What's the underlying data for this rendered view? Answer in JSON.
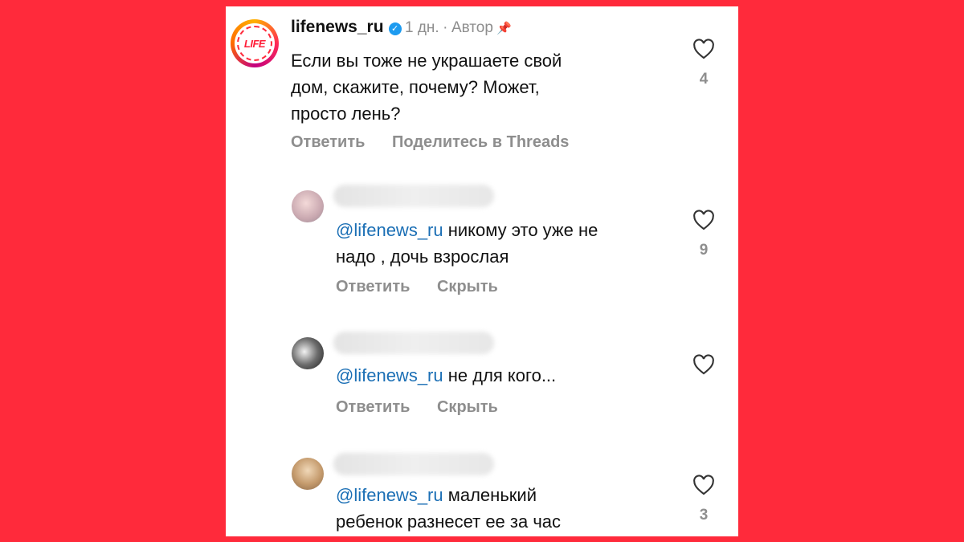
{
  "main_comment": {
    "username": "lifenews_ru",
    "logo_text": "LIFE",
    "time": "1 дн.",
    "separator": "·",
    "author_label": "Автор",
    "lines": [
      "Если вы тоже не украшаете свой",
      "дом, скажите, почему? Может,",
      "просто лень?"
    ],
    "reply_label": "Ответить",
    "share_label": "Поделитесь в Threads",
    "likes": "4"
  },
  "replies": [
    {
      "mention": "@lifenews_ru",
      "lines": [
        " никому это уже не",
        "надо , дочь взрослая"
      ],
      "reply_label": "Ответить",
      "hide_label": "Скрыть",
      "likes": "9"
    },
    {
      "mention": "@lifenews_ru",
      "lines": [
        " не для кого..."
      ],
      "reply_label": "Ответить",
      "hide_label": "Скрыть",
      "likes": ""
    },
    {
      "mention": "@lifenews_ru",
      "lines": [
        " маленький",
        "ребенок разнесет ее за час"
      ],
      "likes": "3"
    }
  ],
  "icons": {
    "verified": "verified-badge-icon",
    "pin": "pin-icon",
    "like": "heart-outline-icon"
  },
  "colors": {
    "background": "#ff2a3b",
    "mention": "#1b6fb5",
    "muted": "#8e8e8e",
    "verified": "#1d9bf0"
  }
}
